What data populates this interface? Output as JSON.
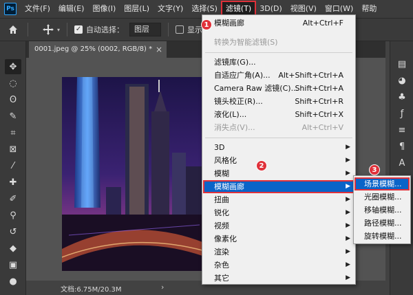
{
  "menubar": {
    "logo": "Ps",
    "items": [
      "文件(F)",
      "编辑(E)",
      "图像(I)",
      "图层(L)",
      "文字(Y)",
      "选择(S)",
      "滤镜(T)",
      "3D(D)",
      "视图(V)",
      "窗口(W)",
      "帮助"
    ]
  },
  "options": {
    "auto_select_label": "自动选择：",
    "layer_select": "图层",
    "show_transform_label": "显示变"
  },
  "document": {
    "tab_title": "0001.jpeg @ 25% (0002, RGB/8) *",
    "tab_close": "×",
    "status": "文档:6.75M/20.3M",
    "status_arrow": "›"
  },
  "filter_menu": {
    "items": [
      {
        "label": "模糊画廊",
        "shortcut": "Alt+Ctrl+F"
      },
      {
        "label": "转换为智能滤镜(S)",
        "shortcut": ""
      },
      {
        "label": "滤镜库(G)...",
        "shortcut": ""
      },
      {
        "label": "自适应广角(A)...",
        "shortcut": "Alt+Shift+Ctrl+A"
      },
      {
        "label": "Camera Raw 滤镜(C)...",
        "shortcut": "Shift+Ctrl+A"
      },
      {
        "label": "镜头校正(R)...",
        "shortcut": "Shift+Ctrl+R"
      },
      {
        "label": "液化(L)...",
        "shortcut": "Shift+Ctrl+X"
      },
      {
        "label": "消失点(V)...",
        "shortcut": "Alt+Ctrl+V"
      },
      {
        "label": "3D",
        "shortcut": ""
      },
      {
        "label": "风格化",
        "shortcut": ""
      },
      {
        "label": "模糊",
        "shortcut": ""
      },
      {
        "label": "模糊画廊",
        "shortcut": ""
      },
      {
        "label": "扭曲",
        "shortcut": ""
      },
      {
        "label": "锐化",
        "shortcut": ""
      },
      {
        "label": "视频",
        "shortcut": ""
      },
      {
        "label": "像素化",
        "shortcut": ""
      },
      {
        "label": "渲染",
        "shortcut": ""
      },
      {
        "label": "杂色",
        "shortcut": ""
      },
      {
        "label": "其它",
        "shortcut": ""
      }
    ]
  },
  "blur_gallery_submenu": {
    "items": [
      "场景模糊...",
      "光圈模糊...",
      "移轴模糊...",
      "路径模糊...",
      "旋转模糊..."
    ]
  },
  "badges": [
    "1",
    "2",
    "3"
  ],
  "icons": {
    "submenu_arrow": "▶",
    "check": "✓"
  },
  "colors": {
    "highlight": "#0a64c8",
    "annotation": "#e0313a"
  }
}
